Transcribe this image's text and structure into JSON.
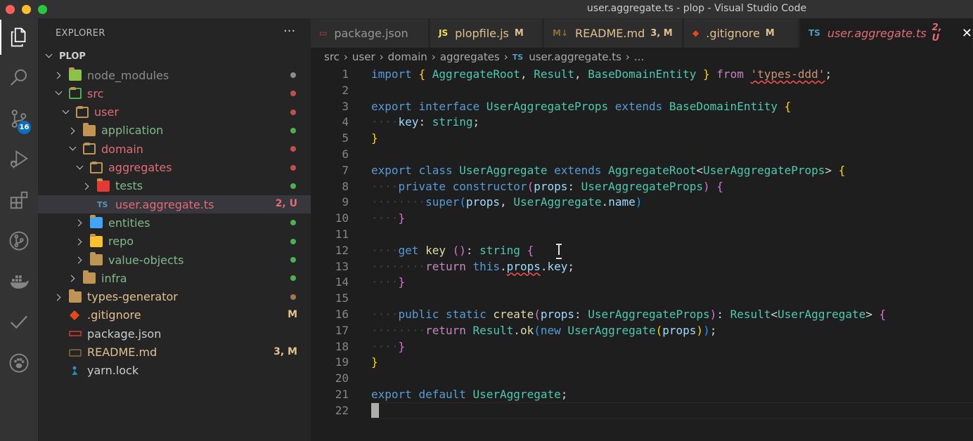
{
  "window": {
    "title": "user.aggregate.ts - plop - Visual Studio Code"
  },
  "activity": {
    "items": [
      "explorer-icon",
      "search-icon",
      "source-control-icon",
      "run-debug-icon",
      "extensions-icon",
      "git-graph-icon",
      "docker-icon",
      "todo-check-icon",
      "paw-icon"
    ],
    "scm_badge": "16"
  },
  "sidebar": {
    "title": "EXPLORER",
    "more": "···",
    "root": "PLOP",
    "rows": [
      {
        "label": "node_modules",
        "depth": 1,
        "kind": "folder",
        "chev": "right",
        "color": "#8c8c8c",
        "dot": "#8c8c8c",
        "icon_color": "#8bc34a"
      },
      {
        "label": "src",
        "depth": 1,
        "kind": "folder-open",
        "chev": "down",
        "color": "#e06c75",
        "dot": "#c24e4e",
        "icon_color": "#4caf50"
      },
      {
        "label": "user",
        "depth": 2,
        "kind": "folder-open",
        "chev": "down",
        "color": "#e06c75",
        "dot": "#c24e4e",
        "icon_color": "#c09553"
      },
      {
        "label": "application",
        "depth": 3,
        "kind": "folder",
        "chev": "right",
        "color": "#81b88b",
        "dot": "#4caf50",
        "icon_color": "#c09553"
      },
      {
        "label": "domain",
        "depth": 3,
        "kind": "folder-open",
        "chev": "down",
        "color": "#e06c75",
        "dot": "#c24e4e",
        "icon_color": "#c09553"
      },
      {
        "label": "aggregates",
        "depth": 4,
        "kind": "folder-open",
        "chev": "down",
        "color": "#e06c75",
        "dot": "#c24e4e",
        "icon_color": "#c09553"
      },
      {
        "label": "tests",
        "depth": 5,
        "kind": "folder",
        "chev": "right",
        "color": "#81b88b",
        "dot": "#4caf50",
        "icon_color": "#e53935"
      },
      {
        "label": "user.aggregate.ts",
        "depth": 5,
        "kind": "ts",
        "chev": "none",
        "color": "#e06c75",
        "status": "2, U",
        "status_color": "#e06c75",
        "selected": true
      },
      {
        "label": "entities",
        "depth": 4,
        "kind": "folder",
        "chev": "right",
        "color": "#81b88b",
        "dot": "#4caf50",
        "icon_color": "#42a5f5"
      },
      {
        "label": "repo",
        "depth": 4,
        "kind": "folder",
        "chev": "right",
        "color": "#81b88b",
        "dot": "#4caf50",
        "icon_color": "#fbc02d"
      },
      {
        "label": "value-objects",
        "depth": 4,
        "kind": "folder",
        "chev": "right",
        "color": "#81b88b",
        "dot": "#4caf50",
        "icon_color": "#c09553"
      },
      {
        "label": "infra",
        "depth": 3,
        "kind": "folder",
        "chev": "right",
        "color": "#81b88b",
        "dot": "#4caf50",
        "icon_color": "#c09553"
      },
      {
        "label": "types-generator",
        "depth": 1,
        "kind": "folder",
        "chev": "right",
        "color": "#e2c08d",
        "dot": "#a07850",
        "icon_color": "#c09553"
      },
      {
        "label": ".gitignore",
        "depth": 1,
        "kind": "git",
        "chev": "none",
        "color": "#e2c08d",
        "status": "M",
        "status_color": "#e2c08d"
      },
      {
        "label": "package.json",
        "depth": 1,
        "kind": "npm",
        "chev": "none",
        "color": "#cccccc"
      },
      {
        "label": "README.md",
        "depth": 1,
        "kind": "md",
        "chev": "none",
        "color": "#e2c08d",
        "status": "3, M",
        "status_color": "#e2c08d"
      },
      {
        "label": "yarn.lock",
        "depth": 1,
        "kind": "yarn",
        "chev": "none",
        "color": "#cccccc"
      }
    ]
  },
  "tabs": [
    {
      "label": "package.json",
      "icon": "npm",
      "icon_text": "▭",
      "icon_color": "#cb3837",
      "color": "#969696",
      "status": ""
    },
    {
      "label": "plopfile.js",
      "icon": "js",
      "icon_text": "JS",
      "icon_color": "#f1e05a",
      "color": "#e2c08d",
      "status": "M"
    },
    {
      "label": "README.md",
      "icon": "md",
      "icon_text": "M↓",
      "icon_color": "#8a6d3b",
      "color": "#e2c08d",
      "status": "3, M"
    },
    {
      "label": ".gitignore",
      "icon": "git",
      "icon_text": "◆",
      "icon_color": "#e64a19",
      "color": "#e2c08d",
      "status": "M"
    },
    {
      "label": "user.aggregate.ts",
      "icon": "ts",
      "icon_text": "TS",
      "icon_color": "#519aba",
      "color": "#e06c75",
      "status": "2, U",
      "active": true
    }
  ],
  "breadcrumb": [
    "src",
    "user",
    "domain",
    "aggregates",
    "user.aggregate.ts",
    "..."
  ],
  "breadcrumb_ts": "TS",
  "editor": {
    "line_numbers": [
      "1",
      "2",
      "3",
      "4",
      "5",
      "6",
      "7",
      "8",
      "9",
      "10",
      "11",
      "12",
      "13",
      "14",
      "15",
      "16",
      "17",
      "18",
      "19",
      "20",
      "21",
      "22"
    ],
    "lines": [
      [
        [
          "k",
          "import "
        ],
        [
          "br1",
          "{ "
        ],
        [
          "ty",
          "AggregateRoot"
        ],
        [
          "p",
          ", "
        ],
        [
          "ty",
          "Result"
        ],
        [
          "p",
          ", "
        ],
        [
          "ty",
          "BaseDomainEntity "
        ],
        [
          "br1",
          "} "
        ],
        [
          "kc",
          "from "
        ],
        [
          "s squig",
          "'types-ddd'"
        ],
        [
          "p",
          ";"
        ]
      ],
      [],
      [
        [
          "k",
          "export "
        ],
        [
          "k",
          "interface "
        ],
        [
          "ty",
          "UserAggregateProps "
        ],
        [
          "k",
          "extends "
        ],
        [
          "ty",
          "BaseDomainEntity "
        ],
        [
          "br1",
          "{"
        ]
      ],
      [
        [
          "ws",
          "····"
        ],
        [
          "v",
          "key"
        ],
        [
          "p",
          ": "
        ],
        [
          "ty",
          "string"
        ],
        [
          "p",
          ";"
        ]
      ],
      [
        [
          "br1",
          "}"
        ]
      ],
      [],
      [
        [
          "k",
          "export "
        ],
        [
          "k",
          "class "
        ],
        [
          "ty",
          "UserAggregate "
        ],
        [
          "k",
          "extends "
        ],
        [
          "ty",
          "AggregateRoot"
        ],
        [
          "p",
          "<"
        ],
        [
          "ty",
          "UserAggregateProps"
        ],
        [
          "p",
          "> "
        ],
        [
          "br1",
          "{"
        ]
      ],
      [
        [
          "ws",
          "····"
        ],
        [
          "k",
          "private "
        ],
        [
          "k",
          "constructor"
        ],
        [
          "br2",
          "("
        ],
        [
          "v",
          "props"
        ],
        [
          "p",
          ": "
        ],
        [
          "ty",
          "UserAggregateProps"
        ],
        [
          "br2",
          ") {"
        ]
      ],
      [
        [
          "ws",
          "········"
        ],
        [
          "k",
          "super"
        ],
        [
          "br3",
          "("
        ],
        [
          "v",
          "props"
        ],
        [
          "p",
          ", "
        ],
        [
          "ty",
          "UserAggregate"
        ],
        [
          "p",
          "."
        ],
        [
          "v",
          "name"
        ],
        [
          "br3",
          ")"
        ]
      ],
      [
        [
          "ws",
          "····"
        ],
        [
          "br2",
          "}"
        ]
      ],
      [],
      [
        [
          "ws",
          "····"
        ],
        [
          "k",
          "get "
        ],
        [
          "fn",
          "key "
        ],
        [
          "br2",
          "()"
        ],
        [
          "p",
          ": "
        ],
        [
          "ty",
          "string "
        ],
        [
          "br2",
          "{"
        ]
      ],
      [
        [
          "ws",
          "········"
        ],
        [
          "kc",
          "return "
        ],
        [
          "k",
          "this"
        ],
        [
          "p",
          "."
        ],
        [
          "v squig",
          "props"
        ],
        [
          "p",
          "."
        ],
        [
          "v",
          "key"
        ],
        [
          "p",
          ";"
        ]
      ],
      [
        [
          "ws",
          "····"
        ],
        [
          "br2",
          "}"
        ]
      ],
      [],
      [
        [
          "ws",
          "····"
        ],
        [
          "k",
          "public "
        ],
        [
          "k",
          "static "
        ],
        [
          "fn",
          "create"
        ],
        [
          "br2",
          "("
        ],
        [
          "v",
          "props"
        ],
        [
          "p",
          ": "
        ],
        [
          "ty",
          "UserAggregateProps"
        ],
        [
          "br2",
          ")"
        ],
        [
          "p",
          ": "
        ],
        [
          "ty",
          "Result"
        ],
        [
          "p",
          "<"
        ],
        [
          "ty",
          "UserAggregate"
        ],
        [
          "p",
          "> "
        ],
        [
          "br2",
          "{"
        ]
      ],
      [
        [
          "ws",
          "········"
        ],
        [
          "kc",
          "return "
        ],
        [
          "ty",
          "Result"
        ],
        [
          "p",
          "."
        ],
        [
          "fn",
          "ok"
        ],
        [
          "br3",
          "("
        ],
        [
          "k",
          "new "
        ],
        [
          "ty",
          "UserAggregate"
        ],
        [
          "br1",
          "("
        ],
        [
          "v",
          "props"
        ],
        [
          "br1",
          ")"
        ],
        [
          "br3",
          ")"
        ],
        [
          "p",
          ";"
        ]
      ],
      [
        [
          "ws",
          "····"
        ],
        [
          "br2",
          "}"
        ]
      ],
      [
        [
          "br1",
          "}"
        ]
      ],
      [],
      [
        [
          "k",
          "export "
        ],
        [
          "k",
          "default "
        ],
        [
          "ty",
          "UserAggregate"
        ],
        [
          "p",
          ";"
        ]
      ],
      []
    ]
  }
}
